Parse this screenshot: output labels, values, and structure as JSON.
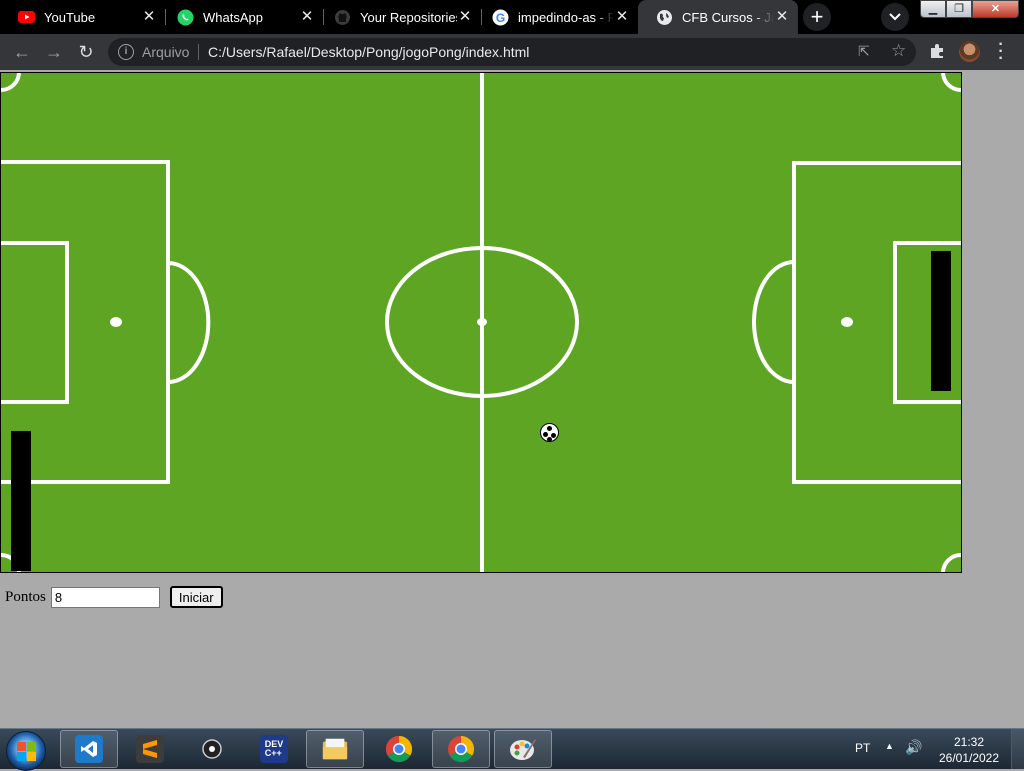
{
  "browser": {
    "tabs": [
      {
        "title": "YouTube",
        "icon": "youtube-icon",
        "active": false
      },
      {
        "title": "WhatsApp",
        "icon": "whatsapp-icon",
        "active": false
      },
      {
        "title": "Your Repositories",
        "icon": "github-icon",
        "active": false
      },
      {
        "title": "impedindo-as - P",
        "icon": "google-icon",
        "active": false
      },
      {
        "title": "CFB Cursos - Java",
        "icon": "globe-icon",
        "active": true
      }
    ],
    "new_tab_label": "+",
    "omnibox": {
      "security_label": "Arquivo",
      "url": "C:/Users/Rafael/Desktop/Pong/jogoPong/index.html"
    }
  },
  "page": {
    "score_label": "Pontos",
    "score_value": "8",
    "start_button_label": "Iniciar",
    "field_color": "#5da523",
    "line_color": "#ffffff"
  },
  "taskbar": {
    "apps": [
      {
        "name": "vscode-icon",
        "pinned": true
      },
      {
        "name": "sublime-icon",
        "pinned": false
      },
      {
        "name": "obs-icon",
        "pinned": false
      },
      {
        "name": "devcpp-icon",
        "pinned": false
      },
      {
        "name": "explorer-icon",
        "pinned": true
      },
      {
        "name": "chrome-icon",
        "pinned": false
      },
      {
        "name": "chrome-icon",
        "pinned": true
      },
      {
        "name": "paint-icon",
        "pinned": true
      }
    ],
    "language": "PT",
    "time": "21:32",
    "date": "26/01/2022"
  }
}
